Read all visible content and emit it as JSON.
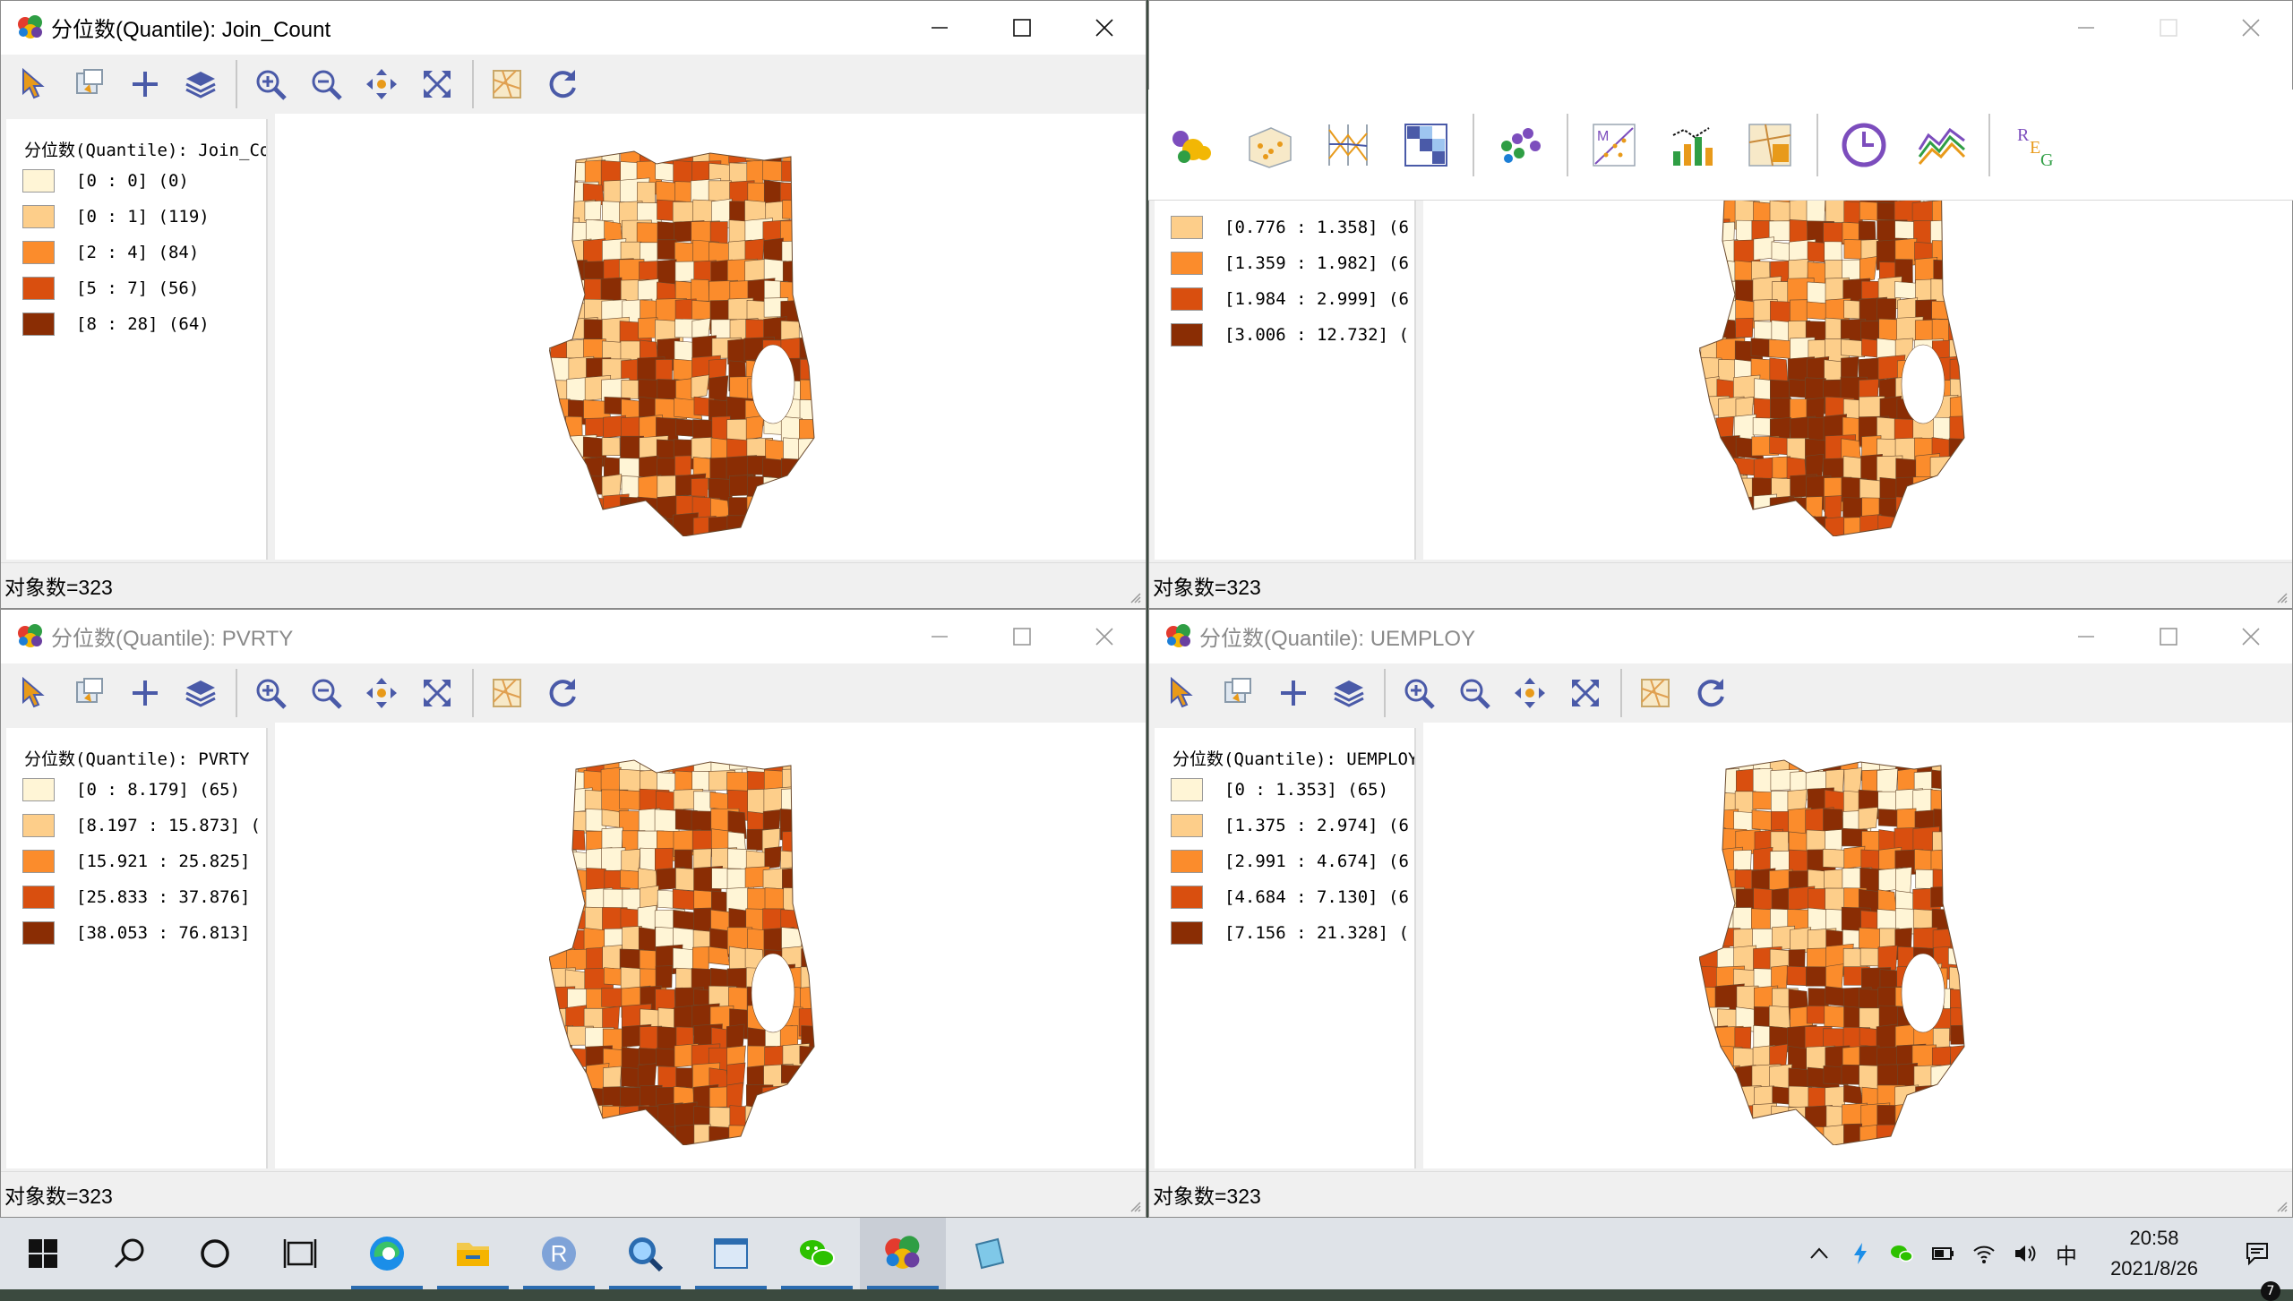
{
  "windows": [
    {
      "id": "join",
      "title": "分位数(Quantile): Join_Count",
      "active": true,
      "legend_title": "分位数(Quantile): Join_Count",
      "legend_rows": [
        {
          "label": "[0 : 0] (0)",
          "color": "#fff5d6"
        },
        {
          "label": "[0 : 1] (119)",
          "color": "#fdce8a"
        },
        {
          "label": "[2 : 4] (84)",
          "color": "#fb8c2c"
        },
        {
          "label": "[5 : 7] (56)",
          "color": "#d94f0f"
        },
        {
          "label": "[8 : 28] (64)",
          "color": "#8a2d04"
        }
      ],
      "status": "对象数=323"
    },
    {
      "id": "rate",
      "title": "",
      "active": false,
      "legend_title": "",
      "legend_rows": [
        {
          "label": "[0.776 : 1.358] (6",
          "color": "#fdce8a"
        },
        {
          "label": "[1.359 : 1.982] (6",
          "color": "#fb8c2c"
        },
        {
          "label": "[1.984 : 2.999] (6",
          "color": "#d94f0f"
        },
        {
          "label": "[3.006 : 12.732] (",
          "color": "#8a2d04"
        }
      ],
      "status": "对象数=323"
    },
    {
      "id": "pvrty",
      "title": "分位数(Quantile): PVRTY",
      "active": false,
      "legend_title": "分位数(Quantile): PVRTY",
      "legend_rows": [
        {
          "label": "[0 : 8.179] (65)",
          "color": "#fff5d6"
        },
        {
          "label": "[8.197 : 15.873] (",
          "color": "#fdce8a"
        },
        {
          "label": "[15.921 : 25.825]",
          "color": "#fb8c2c"
        },
        {
          "label": "[25.833 : 37.876]",
          "color": "#d94f0f"
        },
        {
          "label": "[38.053 : 76.813]",
          "color": "#8a2d04"
        }
      ],
      "status": "对象数=323"
    },
    {
      "id": "uemploy",
      "title": "分位数(Quantile): UEMPLOY",
      "active": false,
      "legend_title": "分位数(Quantile): UEMPLOY",
      "legend_rows": [
        {
          "label": "[0 : 1.353] (65)",
          "color": "#fff5d6"
        },
        {
          "label": "[1.375 : 2.974] (6",
          "color": "#fdce8a"
        },
        {
          "label": "[2.991 : 4.674] (6",
          "color": "#fb8c2c"
        },
        {
          "label": "[4.684 : 7.130] (6",
          "color": "#d94f0f"
        },
        {
          "label": "[7.156 : 21.328] (",
          "color": "#8a2d04"
        }
      ],
      "status": "对象数=323"
    }
  ],
  "map_toolbar_icons": [
    "select-icon",
    "selection-tool-icon",
    "add-icon",
    "layers-icon",
    "zoom-in-icon",
    "zoom-out-icon",
    "pan-icon",
    "full-extent-icon",
    "map-basemap-icon",
    "refresh-icon"
  ],
  "analysis_toolbar_icons": [
    "map-icon",
    "histogram-3d-icon",
    "parallel-coordinates-icon",
    "scatter-matrix-icon",
    "cluster-icon",
    "moran-scatter-icon",
    "bar-chart-icon",
    "cartogram-icon",
    "time-icon",
    "lines-icon",
    "regression-icon"
  ],
  "regression_letters": [
    "R",
    "E",
    "G"
  ],
  "taskbar": {
    "apps": [
      "start-icon",
      "search-icon",
      "cortana-icon",
      "task-view-icon",
      "edge-icon",
      "file-explorer-icon",
      "r-icon",
      "magnifier-app-icon",
      "window-app-icon",
      "wechat-icon",
      "geoda-icon",
      "notes-icon"
    ],
    "r_label": "R",
    "ime": "中",
    "time": "20:58",
    "date": "2021/8/26",
    "notification_count": "7"
  },
  "choropleth_palette": [
    "#fff5d6",
    "#fdce8a",
    "#fb8c2c",
    "#d94f0f",
    "#8a2d04"
  ]
}
